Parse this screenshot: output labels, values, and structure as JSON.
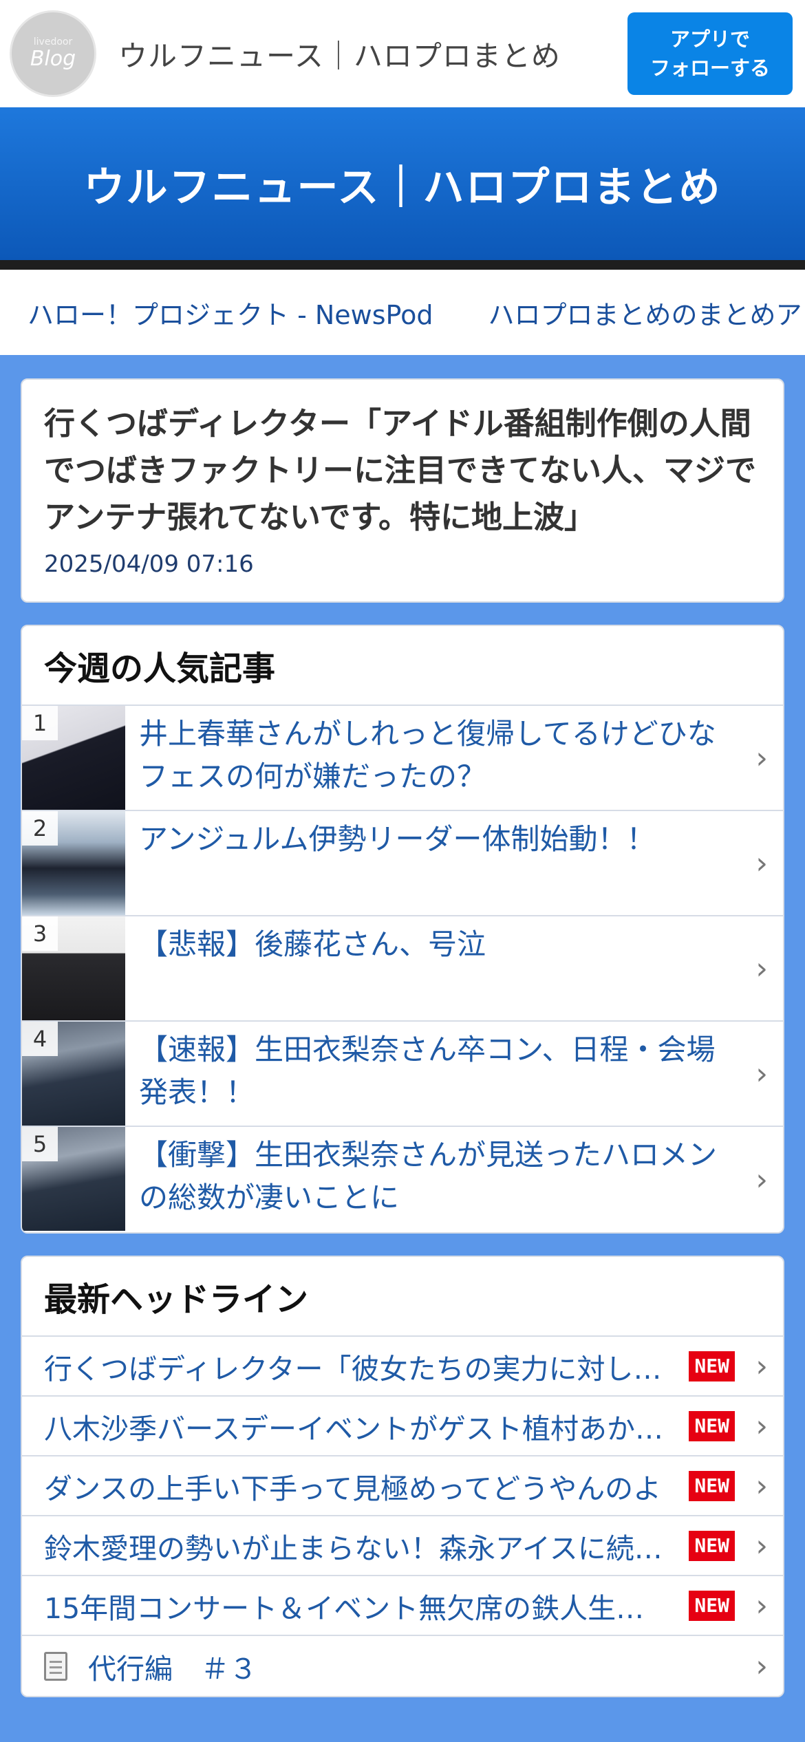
{
  "topbar": {
    "logo_small": "livedoor",
    "logo_big": "Blog",
    "site_name": "ウルフニュース｜ハロプロまとめ",
    "follow_line1": "アプリで",
    "follow_line2": "フォローする"
  },
  "banner": {
    "title": "ウルフニュース｜ハロプロまとめ"
  },
  "nav": {
    "links": [
      "ハロー！プロジェクト - NewsPod",
      "ハロプロまとめのまとめア"
    ]
  },
  "article": {
    "title": "行くつばディレクター「アイドル番組制作側の人間でつばきファクトリーに注目できてない人、マジでアンテナ張れてないです。特に地上波」",
    "date": "2025/04/09 07:16"
  },
  "popular": {
    "heading": "今週の人気記事",
    "items": [
      {
        "rank": "1",
        "title": "井上春華さんがしれっと復帰してるけどひなフェスの何が嫌だったの？"
      },
      {
        "rank": "2",
        "title": "アンジュルム伊勢リーダー体制始動！！"
      },
      {
        "rank": "3",
        "title": "【悲報】後藤花さん、号泣"
      },
      {
        "rank": "4",
        "title": "【速報】生田衣梨奈さん卒コン、日程・会場発表！！"
      },
      {
        "rank": "5",
        "title": "【衝撃】生田衣梨奈さんが見送ったハロメンの総数が凄いことに"
      }
    ],
    "chevron": "›"
  },
  "headlines": {
    "heading": "最新ヘッドライン",
    "new_label": "NEW",
    "items": [
      {
        "title": "行くつばディレクター「彼女たちの実力に対し…"
      },
      {
        "title": "八木沙季バースデーイベントがゲスト植村あか…"
      },
      {
        "title": "ダンスの上手い下手って見極めってどうやんのよ"
      },
      {
        "title": "鈴木愛理の勢いが止まらない！森永アイスに続…"
      },
      {
        "title": "15年間コンサート＆イベント無欠席の鉄人生…"
      }
    ],
    "last_item": "代行編　＃３"
  }
}
